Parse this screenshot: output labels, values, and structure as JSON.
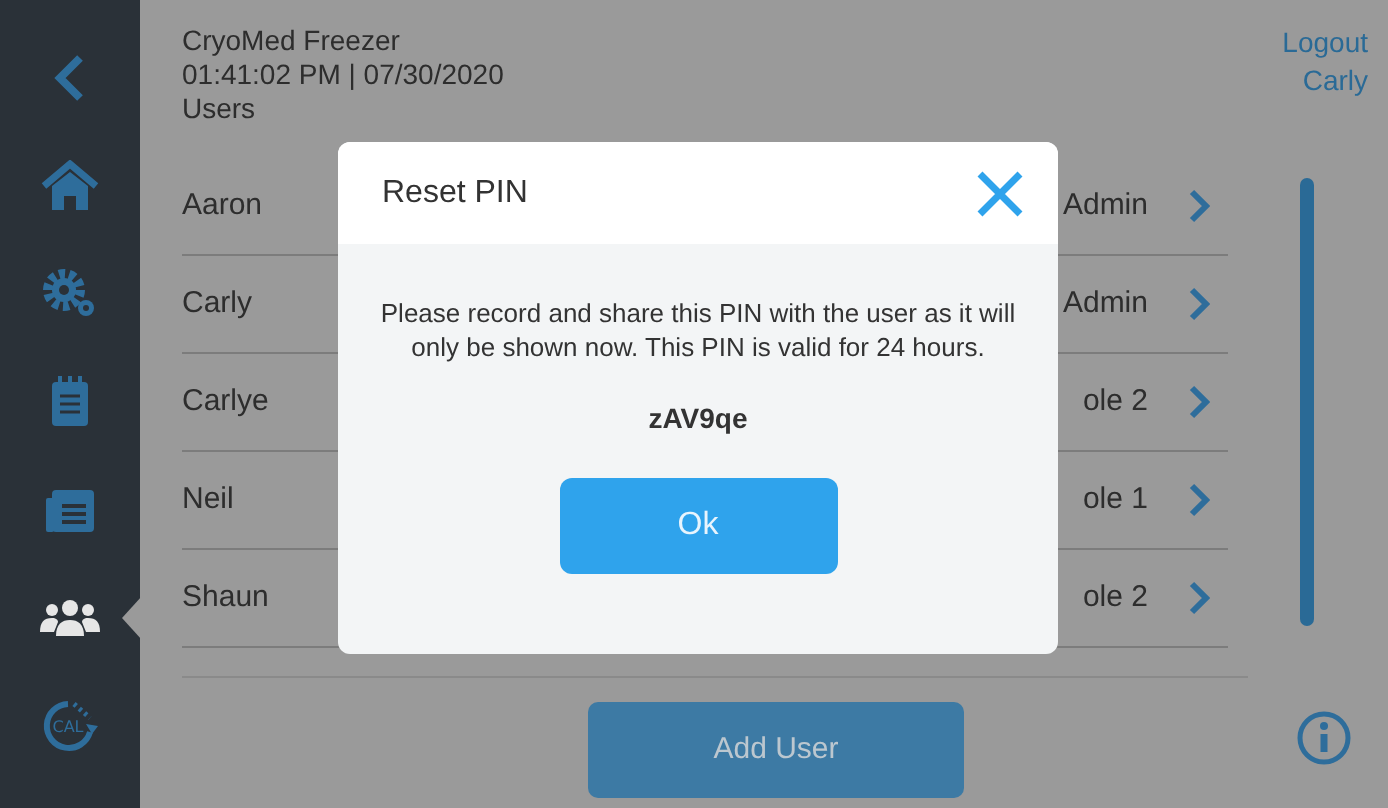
{
  "sidebar": {
    "items": [
      {
        "kind": "back",
        "selected": false
      },
      {
        "kind": "home",
        "selected": false
      },
      {
        "kind": "gears",
        "selected": false
      },
      {
        "kind": "notepad",
        "selected": false
      },
      {
        "kind": "calendar",
        "selected": false
      },
      {
        "kind": "users",
        "selected": true
      },
      {
        "kind": "calibrate",
        "label": "CAL",
        "selected": false
      }
    ]
  },
  "header": {
    "app_title": "CryoMed Freezer",
    "datetime": "01:41:02 PM | 07/30/2020",
    "page_title": "Users",
    "logout": "Logout",
    "user": "Carly"
  },
  "users": [
    {
      "name": "Aaron",
      "role": "Admin"
    },
    {
      "name": "Carly",
      "role": "Admin"
    },
    {
      "name": "Carlye",
      "role": "ole 2"
    },
    {
      "name": "Neil",
      "role": "ole 1"
    },
    {
      "name": "Shaun",
      "role": "ole 2"
    }
  ],
  "add_button": "Add User",
  "dialog": {
    "title": "Reset PIN",
    "message": "Please record and share this PIN with the user as it will only be shown now. This PIN is valid for 24 hours.",
    "pin": "zAV9qe",
    "ok_button": "Ok"
  }
}
